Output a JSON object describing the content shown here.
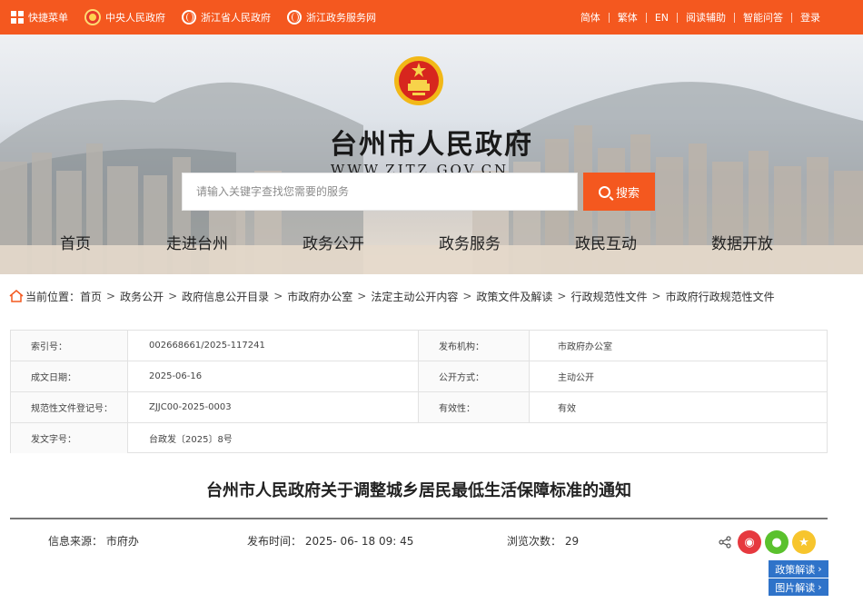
{
  "topbar": {
    "quick_menu": "快捷菜单",
    "links": [
      "中央人民政府",
      "浙江省人民政府",
      "浙江政务服务网"
    ],
    "right_links": [
      "简体",
      "繁体",
      "EN",
      "阅读辅助",
      "智能问答",
      "登录"
    ]
  },
  "banner": {
    "title": "台州市人民政府",
    "url": "WWW.ZJTZ.GOV.CN"
  },
  "search": {
    "placeholder": "请输入关键字查找您需要的服务",
    "button": "搜索"
  },
  "nav": [
    "首页",
    "走进台州",
    "政务公开",
    "政务服务",
    "政民互动",
    "数据开放"
  ],
  "breadcrumb": {
    "prefix": "当前位置：",
    "items": [
      "首页",
      "政务公开",
      "政府信息公开目录",
      "市政府办公室",
      "法定主动公开内容",
      "政策文件及解读",
      "行政规范性文件",
      "市政府行政规范性文件"
    ]
  },
  "info": {
    "index_label": "索引号：",
    "index_value": "002668661/2025-117241",
    "org_label": "发布机构：",
    "org_value": "市政府办公室",
    "date_label": "成文日期：",
    "date_value": "2025-06-16",
    "mode_label": "公开方式：",
    "mode_value": "主动公开",
    "reg_label": "规范性文件登记号：",
    "reg_value": "ZJJC00-2025-0003",
    "valid_label": "有效性：",
    "valid_value": "有效",
    "docno_label": "发文字号：",
    "docno_value": "台政发〔2025〕8号"
  },
  "doc": {
    "title": "台州市人民政府关于调整城乡居民最低生活保障标准的通知",
    "source": "信息来源：  市府办",
    "publish_time": "发布时间：  2025- 06- 18 09: 45",
    "views": "浏览次数：  29"
  },
  "side_tabs": [
    "政策解读",
    "图片解读"
  ],
  "colors": {
    "brand": "#f4581f",
    "side_tab": "#2f73c9",
    "weibo": "#e6393f",
    "wechat": "#5ac12d",
    "favorite": "#f7c52d"
  }
}
